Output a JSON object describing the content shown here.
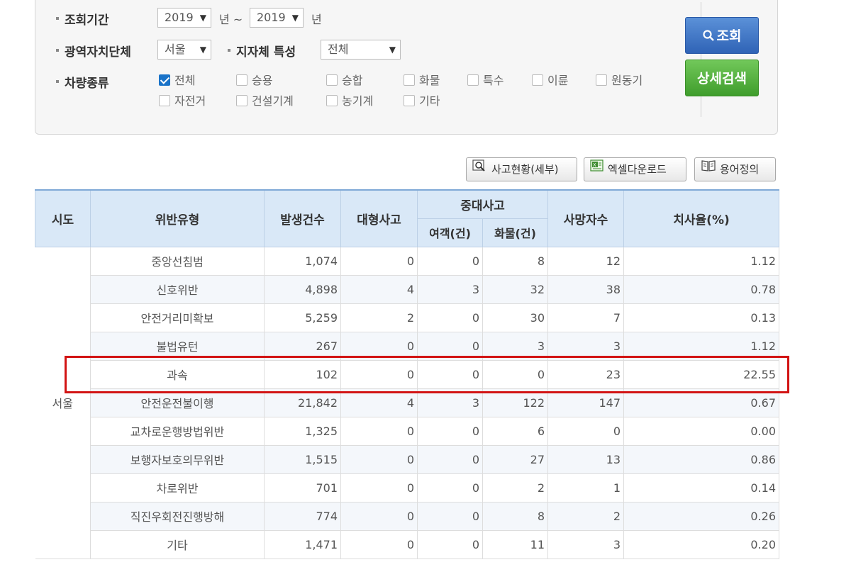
{
  "filters": {
    "period_label": "조회기간",
    "year_from": "2019",
    "year_unit_from": "년 ~",
    "year_to": "2019",
    "year_unit_to": "년",
    "region_label": "광역자치단체",
    "region_value": "서울",
    "municipal_label": "지자체 특성",
    "municipal_value": "전체",
    "vehicle_label": "차량종류",
    "vehicle_types": [
      {
        "label": "전체",
        "checked": true
      },
      {
        "label": "승용",
        "checked": false
      },
      {
        "label": "승합",
        "checked": false
      },
      {
        "label": "화물",
        "checked": false
      },
      {
        "label": "특수",
        "checked": false
      },
      {
        "label": "이륜",
        "checked": false
      },
      {
        "label": "원동기",
        "checked": false
      },
      {
        "label": "자전거",
        "checked": false
      },
      {
        "label": "건설기계",
        "checked": false
      },
      {
        "label": "농기계",
        "checked": false
      },
      {
        "label": "기타",
        "checked": false
      }
    ],
    "search_button": "조회",
    "detail_button": "상세검색"
  },
  "toolbar": {
    "detail_status": "사고현황(세부)",
    "excel_download": "엑셀다운로드",
    "glossary": "용어정의"
  },
  "table": {
    "headers": {
      "sido": "시도",
      "violation": "위반유형",
      "count": "발생건수",
      "major": "대형사고",
      "serious": "중대사고",
      "passenger": "여객(건)",
      "cargo": "화물(건)",
      "deaths": "사망자수",
      "fatality": "치사율(%)"
    },
    "sido": "서울",
    "rows": [
      {
        "violation": "중앙선침범",
        "count": "1,074",
        "major": "0",
        "passenger": "0",
        "cargo": "8",
        "deaths": "12",
        "fatality": "1.12"
      },
      {
        "violation": "신호위반",
        "count": "4,898",
        "major": "4",
        "passenger": "3",
        "cargo": "32",
        "deaths": "38",
        "fatality": "0.78"
      },
      {
        "violation": "안전거리미확보",
        "count": "5,259",
        "major": "2",
        "passenger": "0",
        "cargo": "30",
        "deaths": "7",
        "fatality": "0.13"
      },
      {
        "violation": "불법유턴",
        "count": "267",
        "major": "0",
        "passenger": "0",
        "cargo": "3",
        "deaths": "3",
        "fatality": "1.12"
      },
      {
        "violation": "과속",
        "count": "102",
        "major": "0",
        "passenger": "0",
        "cargo": "0",
        "deaths": "23",
        "fatality": "22.55"
      },
      {
        "violation": "안전운전불이행",
        "count": "21,842",
        "major": "4",
        "passenger": "3",
        "cargo": "122",
        "deaths": "147",
        "fatality": "0.67"
      },
      {
        "violation": "교차로운행방법위반",
        "count": "1,325",
        "major": "0",
        "passenger": "0",
        "cargo": "6",
        "deaths": "0",
        "fatality": "0.00"
      },
      {
        "violation": "보행자보호의무위반",
        "count": "1,515",
        "major": "0",
        "passenger": "0",
        "cargo": "27",
        "deaths": "13",
        "fatality": "0.86"
      },
      {
        "violation": "차로위반",
        "count": "701",
        "major": "0",
        "passenger": "0",
        "cargo": "2",
        "deaths": "1",
        "fatality": "0.14"
      },
      {
        "violation": "직진우회전진행방해",
        "count": "774",
        "major": "0",
        "passenger": "0",
        "cargo": "8",
        "deaths": "2",
        "fatality": "0.26"
      },
      {
        "violation": "기타",
        "count": "1,471",
        "major": "0",
        "passenger": "0",
        "cargo": "11",
        "deaths": "3",
        "fatality": "0.20"
      }
    ]
  },
  "colors": {
    "highlight": "#d21414",
    "header_bg": "#d9e8f7",
    "search_button": "#3a6fc0",
    "detail_button": "#4faa36",
    "checkbox_checked": "#1a73c8"
  }
}
